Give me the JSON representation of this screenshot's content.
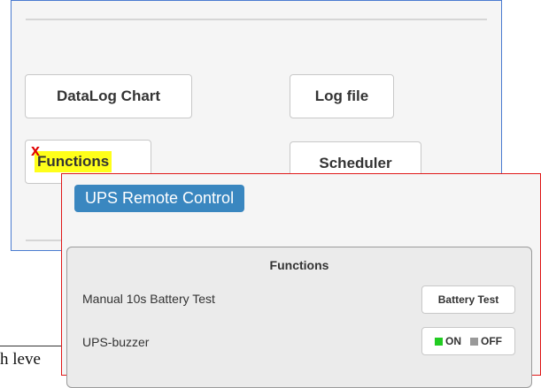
{
  "back_panel": {
    "buttons": {
      "datalog_chart": "DataLog Chart",
      "log_file": "Log file",
      "functions": "Functions",
      "scheduler": "Scheduler"
    },
    "annotation_mark": "x"
  },
  "front_panel": {
    "title": "UPS Remote Control",
    "functions_box": {
      "heading": "Functions",
      "rows": [
        {
          "label": "Manual 10s Battery Test",
          "control_label": "Battery Test"
        },
        {
          "label": "UPS-buzzer",
          "toggle_on": "ON",
          "toggle_off": "OFF"
        }
      ]
    }
  },
  "behind_text": "h leve",
  "colors": {
    "back_panel_border": "#4a7bd0",
    "front_panel_border": "#e01818",
    "title_badge": "#3a87c0",
    "highlight": "#ffff1a",
    "toggle_on": "#22cc22",
    "toggle_off": "#999999",
    "annotation_x": "#e00000"
  },
  "icons": {
    "toggle_on_indicator": "green-square-icon",
    "toggle_off_indicator": "gray-square-icon"
  }
}
